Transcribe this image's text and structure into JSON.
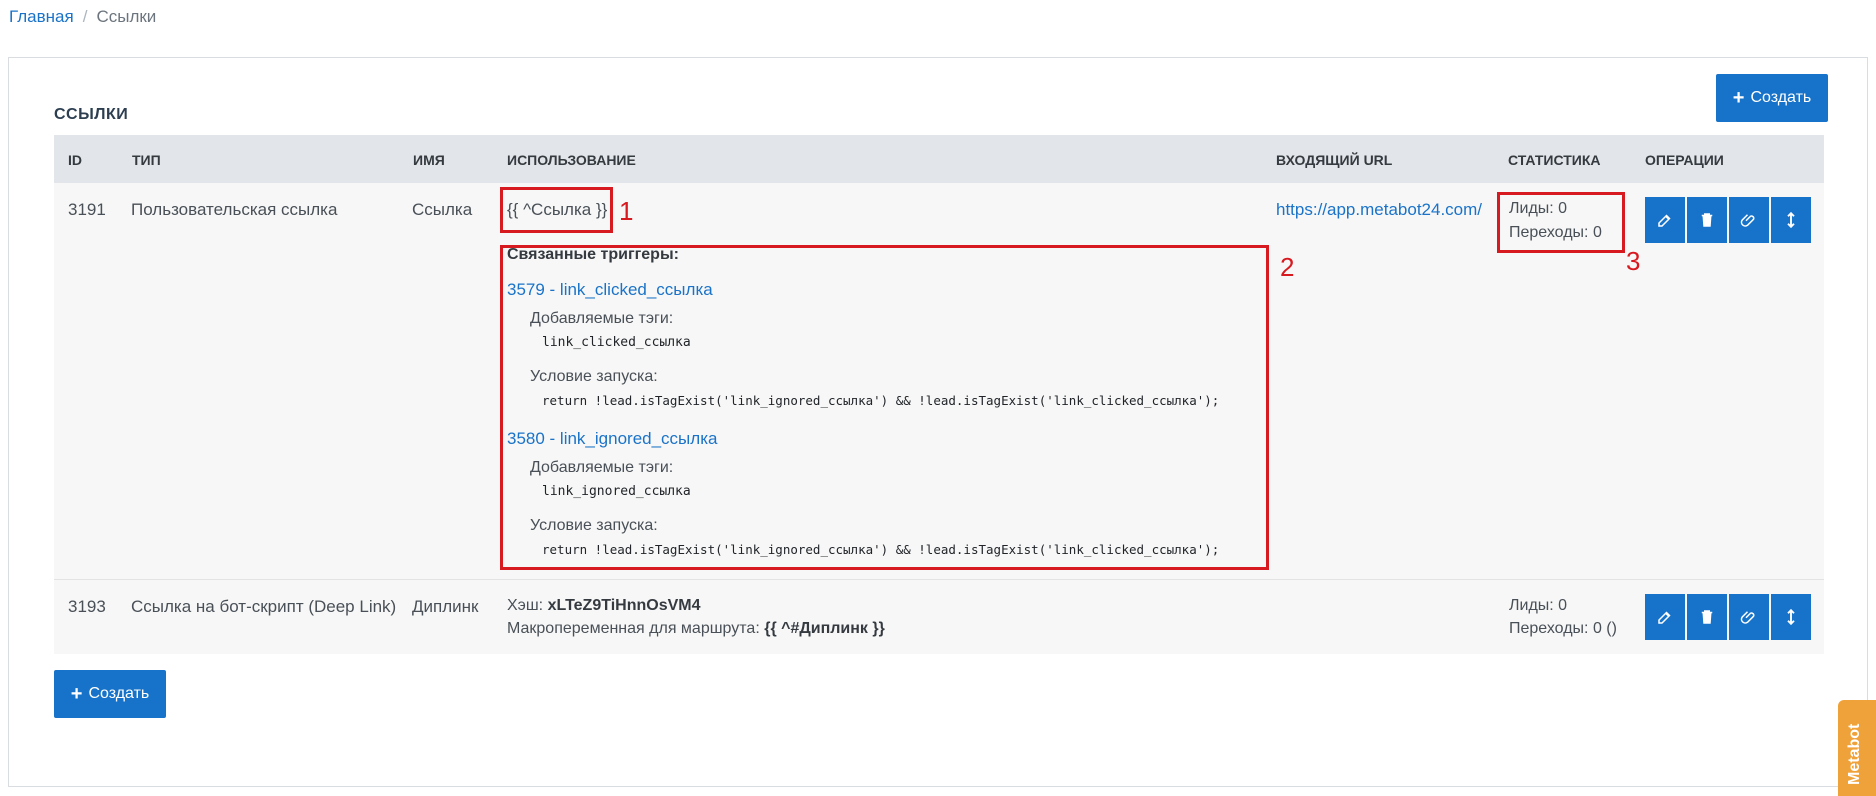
{
  "breadcrumb": {
    "home": "Главная",
    "current": "Ссылки"
  },
  "page_title": "ССЫЛКИ",
  "create_label": "Создать",
  "table": {
    "headers": {
      "id": "ID",
      "type": "ТИП",
      "name": "ИМЯ",
      "usage": "ИСПОЛЬЗОВАНИЕ",
      "url": "ВХОДЯЩИЙ URL",
      "stats": "СТАТИСТИКА",
      "ops": "ОПЕРАЦИИ"
    },
    "rows": [
      {
        "id": "3191",
        "type": "Пользовательская ссылка",
        "name": "Ссылка",
        "usage_macro": "{{ ^Ссылка }}",
        "related_title": "Связанные триггеры:",
        "triggers": [
          {
            "title": "3579 - link_clicked_ссылка",
            "tags_label": "Добавляемые тэги:",
            "tags": "link_clicked_ссылка",
            "cond_label": "Условие запуска:",
            "cond": "return !lead.isTagExist('link_ignored_ссылка') && !lead.isTagExist('link_clicked_ссылка');"
          },
          {
            "title": "3580 - link_ignored_ссылка",
            "tags_label": "Добавляемые тэги:",
            "tags": "link_ignored_ссылка",
            "cond_label": "Условие запуска:",
            "cond": "return !lead.isTagExist('link_ignored_ссылка') && !lead.isTagExist('link_clicked_ссылка');"
          }
        ],
        "url": "https://app.metabot24.com/",
        "leads": "Лиды: 0",
        "clicks": "Переходы: 0"
      },
      {
        "id": "3193",
        "type": "Ссылка на бот-скрипт (Deep Link)",
        "name": "Диплинк",
        "hash_label": "Хэш:",
        "hash": "xLTeZ9TiHnnOsVM4",
        "macro_label": "Макропеременная для маршрута:",
        "macro": "{{ ^#Диплинк }}",
        "leads": "Лиды: 0",
        "clicks": "Переходы: 0 ()"
      }
    ]
  },
  "annotations": [
    "1",
    "2",
    "3"
  ],
  "side_tab": "Metabot",
  "icons": [
    "edit-icon",
    "trash-icon",
    "paperclip-icon",
    "move-icon",
    "plus-icon"
  ],
  "colors": {
    "primary": "#1673c9",
    "link": "#1a73c8",
    "annotation": "#d71920",
    "side_tab": "#f0a23a"
  }
}
